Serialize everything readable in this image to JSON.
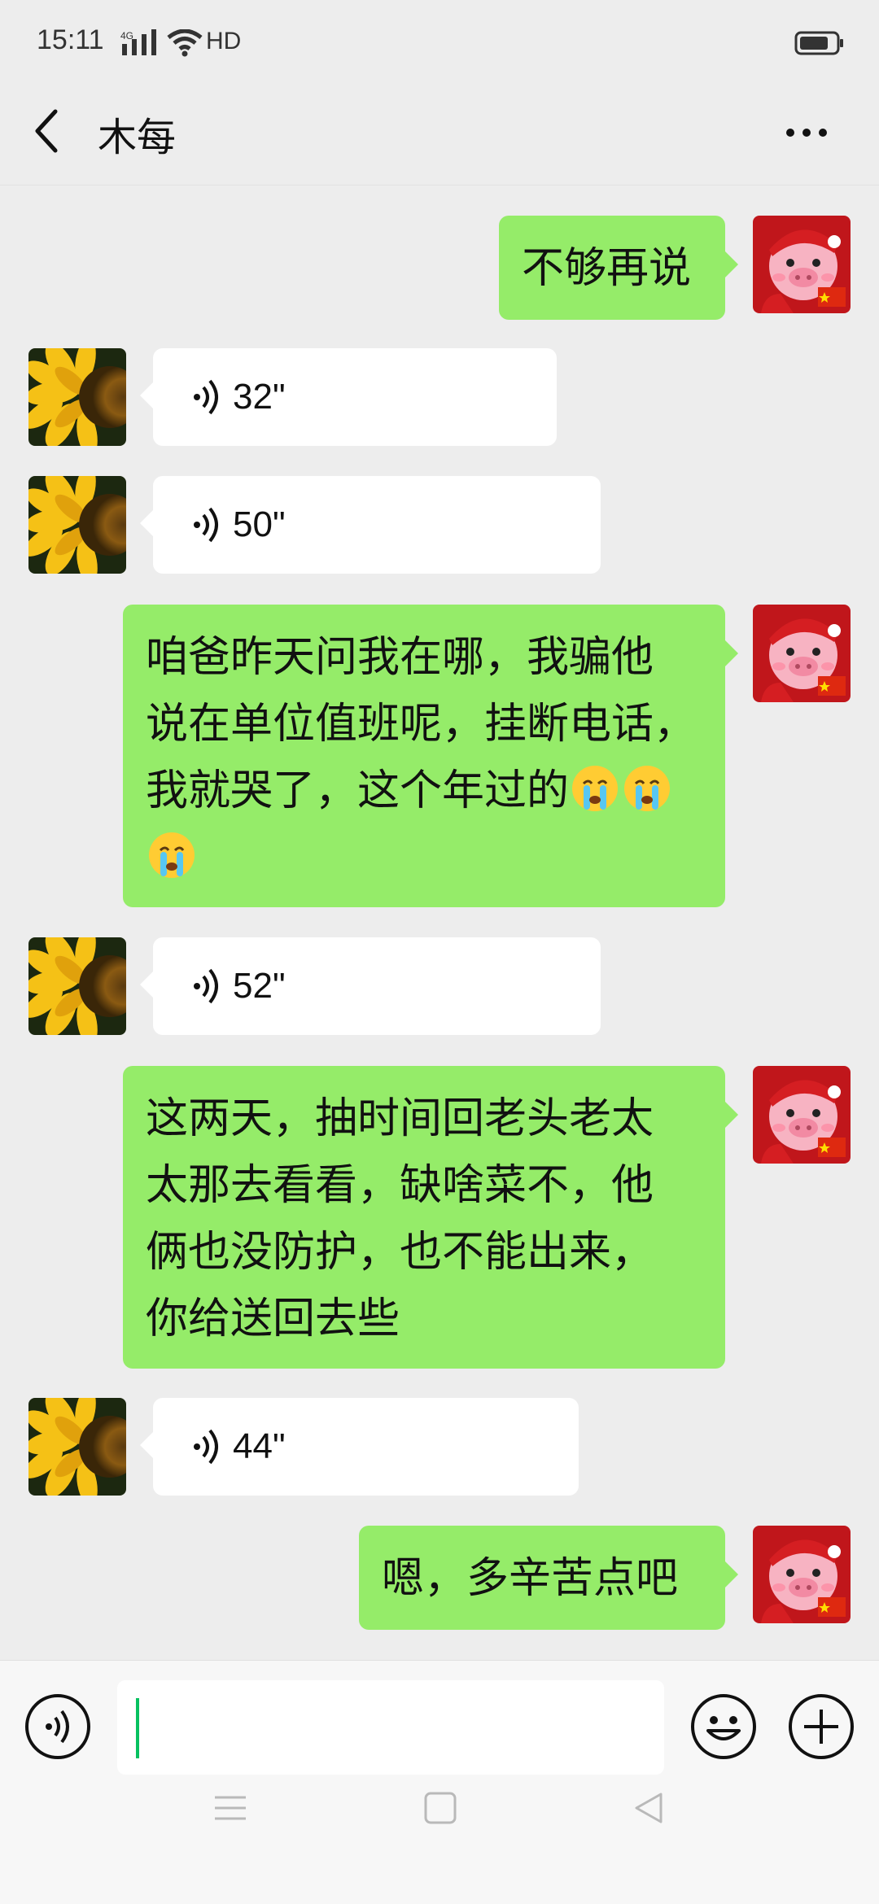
{
  "status_bar": {
    "time": "15:11",
    "network": "4G",
    "wifi_label": "HD"
  },
  "nav": {
    "title": "木每",
    "back_icon": "chevron-left-icon",
    "more_icon": "more-dots-icon"
  },
  "messages": [
    {
      "side": "right",
      "type": "text",
      "text": "不够再说"
    },
    {
      "side": "left",
      "type": "voice",
      "duration": "32\""
    },
    {
      "side": "left",
      "type": "voice",
      "duration": "50\""
    },
    {
      "side": "right",
      "type": "text",
      "lines": [
        "咱爸昨天问我在哪，我骗他",
        "说在单位值班呢，挂断电话，",
        "我就哭了，这个年过的"
      ],
      "emoji": "crying-face-emoji"
    },
    {
      "side": "left",
      "type": "voice",
      "duration": "52\""
    },
    {
      "side": "right",
      "type": "text",
      "lines": [
        "这两天，抽时间回老头老太",
        "太那去看看，缺啥菜不，他",
        "俩也没防护，也不能出来，",
        "你给送回去些"
      ]
    },
    {
      "side": "left",
      "type": "voice",
      "duration": "44\""
    },
    {
      "side": "right",
      "type": "text",
      "text": "嗯，多辛苦点吧"
    }
  ],
  "input_bar": {
    "value": "",
    "voice_icon": "voice-toggle-icon",
    "emoji_icon": "smiley-icon",
    "plus_icon": "plus-icon"
  },
  "colors": {
    "sent_bubble": "#95ec69",
    "received_bubble": "#ffffff",
    "background": "#ededed",
    "caret": "#07c160"
  }
}
